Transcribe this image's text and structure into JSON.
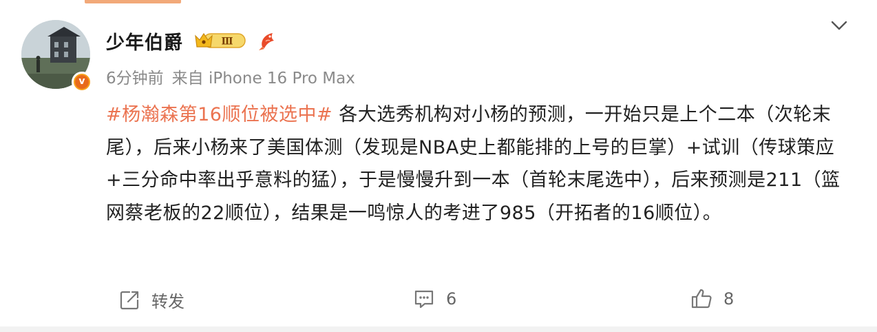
{
  "post": {
    "username": "少年伯爵",
    "level_badge": "Ⅲ",
    "verified_mark": "v",
    "time": "6分钟前",
    "source": "来自 iPhone 16 Pro Max",
    "hashtag": "#杨瀚森第16顺位被选中#",
    "body": " 各大选秀机构对小杨的预测，一开始只是上个二本（次轮末尾），后来小杨来了美国体测（发现是NBA史上都能排的上号的巨掌）+试训（传球策应+三分命中率出乎意料的猛），于是慢慢升到一本（首轮末尾选中），后来预测是211（篮网蔡老板的22顺位），结果是一鸣惊人的考进了985（开拓者的16顺位）。"
  },
  "actions": {
    "repost_label": "转发",
    "comment_count": "6",
    "like_count": "8"
  },
  "icons": [
    "chevron-down-icon",
    "level-crown-badge",
    "koi-fish-icon",
    "repost-icon",
    "comment-icon",
    "like-icon"
  ],
  "colors": {
    "hashtag": "#eb7350",
    "verified": "#f8a21c",
    "text": "#222222",
    "meta": "#8a8a8a"
  }
}
